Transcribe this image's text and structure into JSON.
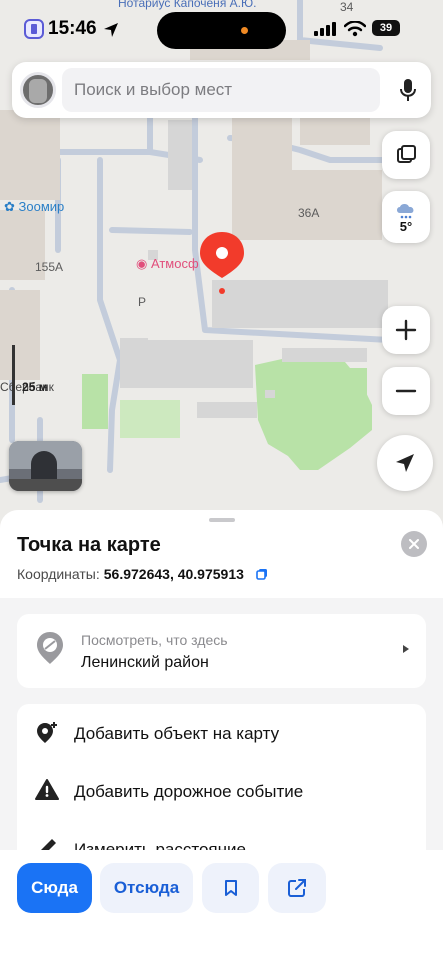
{
  "status_bar": {
    "time": "15:46",
    "battery": "39"
  },
  "search": {
    "placeholder": "Поиск и выбор мест"
  },
  "map": {
    "labels": {
      "notary": "Нотариус Капочёня А.Ю.",
      "house_34": "34",
      "zoomir": "Зоомир",
      "house_36a": "36А",
      "house_155a": "155А",
      "atmosfera": "Атмосф",
      "parking": "P",
      "sberbank": "Сбербанк",
      "scale": "25 м"
    },
    "weather": {
      "temp": "5°"
    }
  },
  "sheet": {
    "title": "Точка на карте",
    "coords_label": "Координаты:",
    "coords_value": "56.972643, 40.975913",
    "whats_here": {
      "subtitle": "Посмотреть, что здесь",
      "district": "Ленинский район"
    },
    "menu": [
      {
        "label": "Добавить объект на карту"
      },
      {
        "label": "Добавить дорожное событие"
      },
      {
        "label": "Измерить расстояние"
      }
    ]
  },
  "actions": {
    "here": "Сюда",
    "from": "Отсюда"
  },
  "colors": {
    "accent": "#1a73f5",
    "pin": "#f23b2b"
  }
}
